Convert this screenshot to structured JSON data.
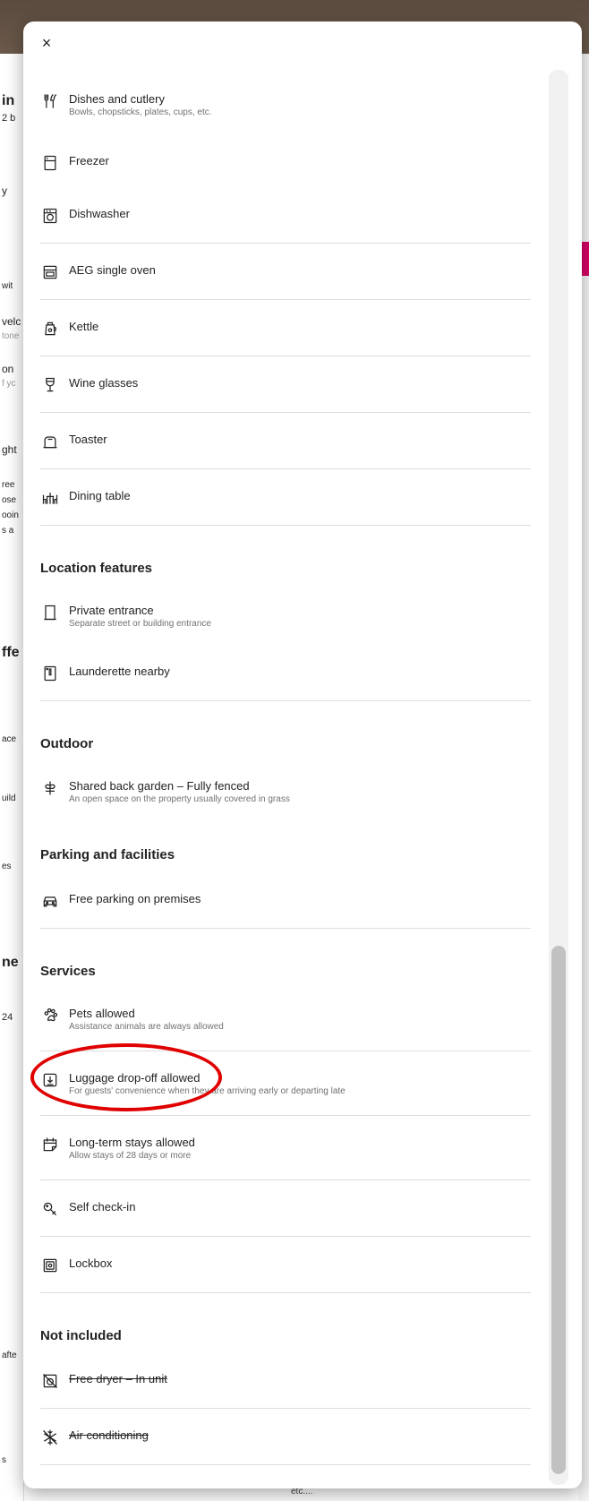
{
  "background": {
    "left_fragments": [
      "in",
      "2 b",
      "y",
      "wit",
      "velc",
      "tone",
      "on",
      "f yc",
      "ght",
      "ree",
      "ose",
      "ooin",
      "s a",
      "ffe",
      "ace",
      "uild",
      "es",
      "ne",
      "24",
      "afte",
      "s"
    ],
    "bottom_text": "etc...."
  },
  "modal": {
    "close_label": "×",
    "kitchen_items": [
      {
        "title": "Dishes and cutlery",
        "sub": "Bowls, chopsticks, plates, cups, etc.",
        "icon": "cutlery-icon"
      },
      {
        "title": "Freezer",
        "sub": "",
        "icon": "freezer-icon"
      },
      {
        "title": "Dishwasher",
        "sub": "",
        "icon": "dishwasher-icon"
      },
      {
        "title": "AEG single oven",
        "sub": "",
        "icon": "oven-icon"
      },
      {
        "title": "Kettle",
        "sub": "",
        "icon": "kettle-icon"
      },
      {
        "title": "Wine glasses",
        "sub": "",
        "icon": "wine-glass-icon"
      },
      {
        "title": "Toaster",
        "sub": "",
        "icon": "toaster-icon"
      },
      {
        "title": "Dining table",
        "sub": "",
        "icon": "dining-table-icon"
      }
    ],
    "location": {
      "title": "Location features",
      "items": [
        {
          "title": "Private entrance",
          "sub": "Separate street or building entrance",
          "icon": "door-icon"
        },
        {
          "title": "Launderette nearby",
          "sub": "",
          "icon": "washer-icon"
        }
      ]
    },
    "outdoor": {
      "title": "Outdoor",
      "items": [
        {
          "title": "Shared back garden – Fully fenced",
          "sub": "An open space on the property usually covered in grass",
          "icon": "plant-icon"
        }
      ]
    },
    "parking": {
      "title": "Parking and facilities",
      "items": [
        {
          "title": "Free parking on premises",
          "sub": "",
          "icon": "car-icon"
        }
      ]
    },
    "services": {
      "title": "Services",
      "items": [
        {
          "title": "Pets allowed",
          "sub": "Assistance animals are always allowed",
          "icon": "paw-icon"
        },
        {
          "title": "Luggage drop-off allowed",
          "sub": "For guests' convenience when they are arriving early or departing late",
          "icon": "luggage-icon"
        },
        {
          "title": "Long-term stays allowed",
          "sub": "Allow stays of 28 days or more",
          "icon": "calendar-icon"
        },
        {
          "title": "Self check-in",
          "sub": "",
          "icon": "key-icon"
        },
        {
          "title": "Lockbox",
          "sub": "",
          "icon": "lockbox-icon"
        }
      ]
    },
    "not_included": {
      "title": "Not included",
      "items": [
        {
          "title": "Free dryer – In unit",
          "sub": "",
          "icon": "dryer-off-icon"
        },
        {
          "title": "Air conditioning",
          "sub": "",
          "icon": "snowflake-off-icon"
        }
      ]
    }
  }
}
